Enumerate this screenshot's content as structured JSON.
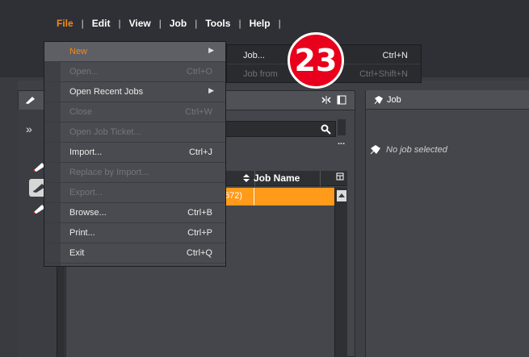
{
  "menubar": {
    "items": [
      "File",
      "Edit",
      "View",
      "Job",
      "Tools",
      "Help"
    ],
    "active_index": 0,
    "accent_color": "#f08a1c"
  },
  "file_menu": {
    "items": [
      {
        "label": "New",
        "shortcut": "",
        "has_submenu": true,
        "enabled": true,
        "highlight": true
      },
      {
        "label": "Open...",
        "shortcut": "Ctrl+O",
        "has_submenu": false,
        "enabled": false
      },
      {
        "label": "Open Recent Jobs",
        "shortcut": "",
        "has_submenu": true,
        "enabled": true
      },
      {
        "label": "Close",
        "shortcut": "Ctrl+W",
        "has_submenu": false,
        "enabled": false
      },
      {
        "label": "Open Job Ticket...",
        "shortcut": "",
        "has_submenu": false,
        "enabled": false
      },
      {
        "label": "Import...",
        "shortcut": "Ctrl+J",
        "has_submenu": false,
        "enabled": true
      },
      {
        "label": "Replace by Import...",
        "shortcut": "",
        "has_submenu": false,
        "enabled": false
      },
      {
        "label": "Export...",
        "shortcut": "",
        "has_submenu": false,
        "enabled": false
      },
      {
        "label": "Browse...",
        "shortcut": "Ctrl+B",
        "has_submenu": false,
        "enabled": true
      },
      {
        "label": "Print...",
        "shortcut": "Ctrl+P",
        "has_submenu": false,
        "enabled": true
      },
      {
        "label": "Exit",
        "shortcut": "Ctrl+Q",
        "has_submenu": false,
        "enabled": true
      }
    ]
  },
  "new_submenu": {
    "items": [
      {
        "label": "Job...",
        "shortcut": "Ctrl+N",
        "enabled": true
      },
      {
        "label": "Job from",
        "shortcut": "Ctrl+Shift+N",
        "enabled": false
      }
    ]
  },
  "callout": {
    "number": "23",
    "color": "#e8001c"
  },
  "left_panel": {
    "chevrons": "»",
    "table": {
      "column_job_name": "Job Name",
      "selected_row_partial": "672)",
      "selection_color": "#ff9a1a"
    },
    "ellipsis": "..."
  },
  "right_panel": {
    "title": "Job",
    "empty_message": "No job selected"
  },
  "icons": {
    "search": "magnifier-icon",
    "split": "split-view-icon",
    "panel": "panel-toggle-icon",
    "job": "job-leaf-icon",
    "pen": "pen-tool-icon"
  }
}
